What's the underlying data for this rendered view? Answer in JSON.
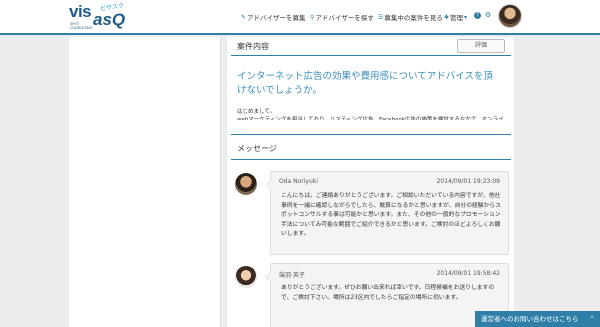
{
  "logo": {
    "main_1": "vis",
    "main_2": "asQ",
    "kana": "ビザスク",
    "sub_1": "SPOT",
    "sub_2": "CONSULTING"
  },
  "nav": {
    "items": [
      {
        "label": "アドバイザーを募集",
        "icon": "edit-icon"
      },
      {
        "label": "アドバイザーを探す",
        "icon": "search-icon"
      },
      {
        "label": "募集中の案件を見る",
        "icon": "list-icon"
      },
      {
        "label": "管理",
        "icon": "settings-icon"
      }
    ],
    "help_label": "?",
    "gear_glyph": "⚙",
    "avatar": "user-avatar"
  },
  "case": {
    "section_title": "案件内容",
    "eval_button": "評価",
    "title": "インターネット広告の効果や費用感についてアドバイスを頂けないでしょうか。",
    "greeting": "はじめまして。",
    "body_clipped": "webマーケティングを担当しており、リスティング広告、Facebook広告の施策を検討するなかで、オンライ"
  },
  "messages": {
    "section_title": "メッセージ",
    "items": [
      {
        "name": "Oda Noriyuki",
        "time": "2014/09/01 19:23:09",
        "text": "こんにちは。ご連絡ありがとうございます。ご相談いただいている内容ですが、他社事例を一緒に確認しながらでしたら、概算になるかと思いますが、自分の経験からスポットコンサルする事は可能かと思います。また、その他の一般的なプロモーション手法についてみ可能な範囲でご紹介できるかと思います。ご検討のほどよろしくお願いします。"
      },
      {
        "name": "端羽 英子",
        "time": "2014/09/01 19:58:42",
        "text": "ありがとうございます。ぜひお願い出来れば幸いです。日程候補をお送りしますので、ご検討下さい。場所は23区内でしたらご指定の場所に伺います。"
      }
    ]
  },
  "contact_bar": {
    "label": "運営者へのお問い合わせはこちら",
    "chevron": "⌃"
  },
  "colors": {
    "accent": "#2f7fa8",
    "title_blue": "#3a8fbf"
  }
}
